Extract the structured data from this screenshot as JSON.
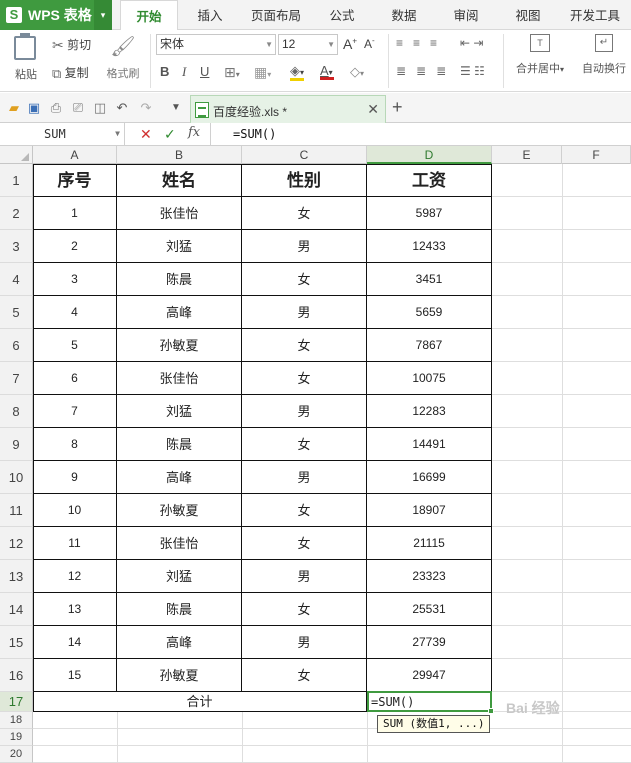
{
  "app": {
    "name": "WPS 表格",
    "logo_letter": "S"
  },
  "menu": {
    "tabs": [
      "开始",
      "插入",
      "页面布局",
      "公式",
      "数据",
      "审阅",
      "视图",
      "开发工具"
    ],
    "active": "开始"
  },
  "ribbon": {
    "paste": "粘贴",
    "cut": "剪切",
    "copy": "复制",
    "format_painter": "格式刷",
    "font_name": "宋体",
    "font_size": "12",
    "bold": "B",
    "italic": "I",
    "underline": "U",
    "merge_center": "合并居中",
    "wrap_text": "自动换行"
  },
  "doc_tab": {
    "title": "百度经验.xls *"
  },
  "formula_bar": {
    "name_box": "SUM",
    "formula": "=SUM()",
    "fx": "fx"
  },
  "columns": [
    "A",
    "B",
    "C",
    "D",
    "E",
    "F"
  ],
  "row_numbers": [
    "1",
    "2",
    "3",
    "4",
    "5",
    "6",
    "7",
    "8",
    "9",
    "10",
    "11",
    "12",
    "13",
    "14",
    "15",
    "16",
    "17",
    "18",
    "19",
    "20"
  ],
  "table": {
    "headers": [
      "序号",
      "姓名",
      "性别",
      "工资"
    ],
    "rows": [
      [
        "1",
        "张佳怡",
        "女",
        "5987"
      ],
      [
        "2",
        "刘猛",
        "男",
        "12433"
      ],
      [
        "3",
        "陈晨",
        "女",
        "3451"
      ],
      [
        "4",
        "高峰",
        "男",
        "5659"
      ],
      [
        "5",
        "孙敏夏",
        "女",
        "7867"
      ],
      [
        "6",
        "张佳怡",
        "女",
        "10075"
      ],
      [
        "7",
        "刘猛",
        "男",
        "12283"
      ],
      [
        "8",
        "陈晨",
        "女",
        "14491"
      ],
      [
        "9",
        "高峰",
        "男",
        "16699"
      ],
      [
        "10",
        "孙敏夏",
        "女",
        "18907"
      ],
      [
        "11",
        "张佳怡",
        "女",
        "21115"
      ],
      [
        "12",
        "刘猛",
        "男",
        "23323"
      ],
      [
        "13",
        "陈晨",
        "女",
        "25531"
      ],
      [
        "14",
        "高峰",
        "男",
        "27739"
      ],
      [
        "15",
        "孙敏夏",
        "女",
        "29947"
      ]
    ],
    "total_label": "合计",
    "editing_cell": "=SUM()"
  },
  "tooltip": "SUM (数值1, ...)",
  "watermark": "Bai 经验",
  "colors": {
    "accent": "#3f9a3f",
    "active_tab_text": "#2f8a2f"
  }
}
